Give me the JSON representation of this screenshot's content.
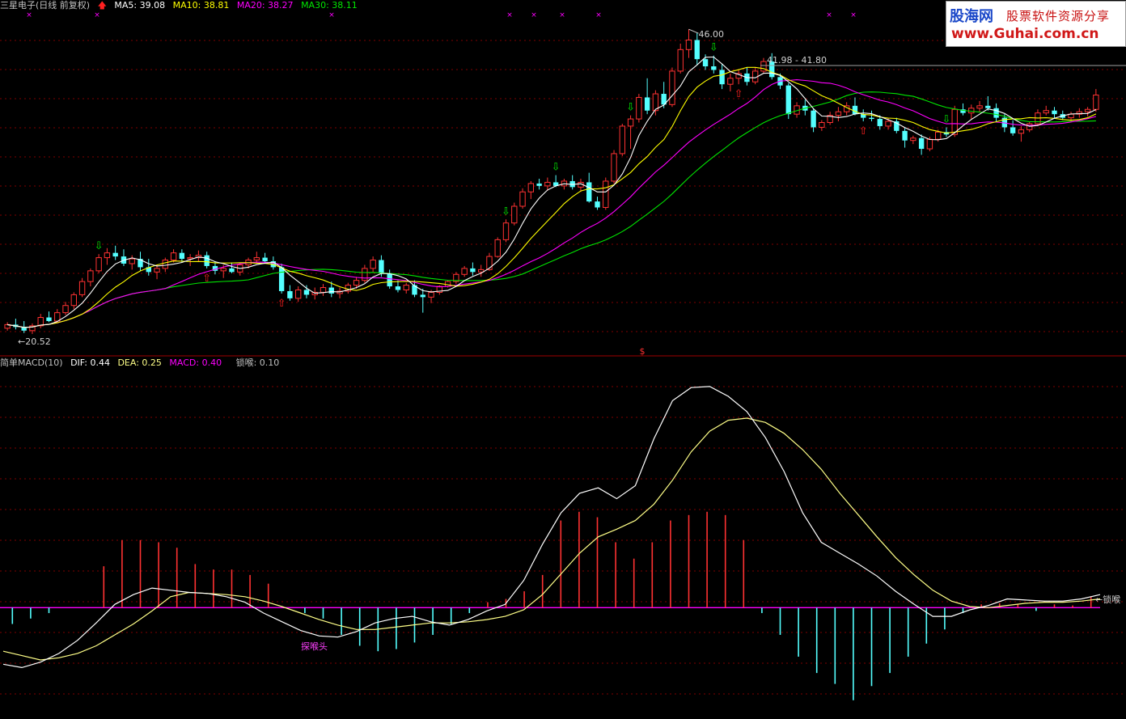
{
  "header": {
    "title": "三星电子(日线 前复权)",
    "ma5": "MA5: 39.08",
    "ma10": "MA10: 38.81",
    "ma20": "MA20: 38.27",
    "ma30": "MA30: 38.11"
  },
  "indicator": {
    "title": "简单MACD(10)",
    "dif": "DIF: 0.44",
    "dea": "DEA: 0.25",
    "macd": "MACD: 0.40",
    "lock": "锁喉: 0.10"
  },
  "annotations": {
    "low_price": "20.52",
    "high_price": "46.00",
    "range_label": "41.98 - 41.80",
    "lock_label": "锁喉",
    "tanhou_label": "探喉头",
    "s_marker": "$"
  },
  "logo": {
    "brand": "股海网",
    "slogan": "股票软件资源分享",
    "url": "www.Guhai.com.cn"
  },
  "colors": {
    "background": "#000000",
    "up_candle": "#ff3232",
    "down_candle": "#54ffff",
    "ma5": "#ffffff",
    "ma10": "#ffff00",
    "ma20": "#ff00ff",
    "ma30": "#00e600",
    "grid": "#800000",
    "macd_pos": "#ff3232",
    "macd_neg": "#54ffff",
    "zero_line": "#ff00ff",
    "dif": "#ffffff",
    "dea": "#ffff88"
  },
  "chart_data": [
    {
      "type": "candlestick",
      "title": "三星电子(日线 前复权)",
      "ylim": [
        19.5,
        47.5
      ],
      "grid": true,
      "candles": [
        [
          21.0,
          21.5,
          20.8,
          21.3
        ],
        [
          21.3,
          21.8,
          20.9,
          21.1
        ],
        [
          21.1,
          21.6,
          20.6,
          20.8
        ],
        [
          20.8,
          21.4,
          20.52,
          21.2
        ],
        [
          21.2,
          22.2,
          21.0,
          21.9
        ],
        [
          21.9,
          22.4,
          21.5,
          21.6
        ],
        [
          21.6,
          22.6,
          21.4,
          22.3
        ],
        [
          22.3,
          23.2,
          22.1,
          22.9
        ],
        [
          22.9,
          24.0,
          22.6,
          23.8
        ],
        [
          23.8,
          25.2,
          23.6,
          24.9
        ],
        [
          24.9,
          26.0,
          24.5,
          25.8
        ],
        [
          25.8,
          27.2,
          25.6,
          26.9
        ],
        [
          26.9,
          27.7,
          26.3,
          27.3
        ],
        [
          27.3,
          27.9,
          26.7,
          27.0
        ],
        [
          27.0,
          27.6,
          26.2,
          26.4
        ],
        [
          26.4,
          27.1,
          25.9,
          26.8
        ],
        [
          26.8,
          27.4,
          25.8,
          26.1
        ],
        [
          26.1,
          26.8,
          25.4,
          25.7
        ],
        [
          25.7,
          26.3,
          25.1,
          26.0
        ],
        [
          26.0,
          26.9,
          25.7,
          26.7
        ],
        [
          26.7,
          27.6,
          26.5,
          27.3
        ],
        [
          27.3,
          27.6,
          26.5,
          26.8
        ],
        [
          26.8,
          27.2,
          26.2,
          26.9
        ],
        [
          26.9,
          27.5,
          26.6,
          27.1
        ],
        [
          27.1,
          27.4,
          26.0,
          26.2
        ],
        [
          26.2,
          26.6,
          25.5,
          25.8
        ],
        [
          25.8,
          26.3,
          25.2,
          26.0
        ],
        [
          26.0,
          26.5,
          25.6,
          25.7
        ],
        [
          25.7,
          26.5,
          25.4,
          26.3
        ],
        [
          26.3,
          26.9,
          26.0,
          26.7
        ],
        [
          26.7,
          27.4,
          26.4,
          26.9
        ],
        [
          26.9,
          27.3,
          26.4,
          26.6
        ],
        [
          26.6,
          27.0,
          25.9,
          26.1
        ],
        [
          26.1,
          26.4,
          23.9,
          24.1
        ],
        [
          24.1,
          24.6,
          23.3,
          23.5
        ],
        [
          23.5,
          24.5,
          23.2,
          24.2
        ],
        [
          24.2,
          24.6,
          23.5,
          23.8
        ],
        [
          23.8,
          24.4,
          23.4,
          24.0
        ],
        [
          24.0,
          24.7,
          23.7,
          24.4
        ],
        [
          24.4,
          24.9,
          23.6,
          23.9
        ],
        [
          23.9,
          24.4,
          23.5,
          24.1
        ],
        [
          24.1,
          24.8,
          23.9,
          24.6
        ],
        [
          24.6,
          25.3,
          24.3,
          25.0
        ],
        [
          25.0,
          26.3,
          24.8,
          26.0
        ],
        [
          26.0,
          27.0,
          25.7,
          26.7
        ],
        [
          26.7,
          27.1,
          25.3,
          25.6
        ],
        [
          25.6,
          25.9,
          24.3,
          24.5
        ],
        [
          24.5,
          25.0,
          24.0,
          24.2
        ],
        [
          24.2,
          24.8,
          23.9,
          24.6
        ],
        [
          24.6,
          25.0,
          23.6,
          23.8
        ],
        [
          23.8,
          24.3,
          22.3,
          23.6
        ],
        [
          23.6,
          24.2,
          23.1,
          24.0
        ],
        [
          24.0,
          24.6,
          23.8,
          24.5
        ],
        [
          24.5,
          25.0,
          24.4,
          24.9
        ],
        [
          24.9,
          25.7,
          24.7,
          25.5
        ],
        [
          25.5,
          26.2,
          25.3,
          26.0
        ],
        [
          26.0,
          26.5,
          25.4,
          25.7
        ],
        [
          25.7,
          26.3,
          25.3,
          25.9
        ],
        [
          25.9,
          27.3,
          25.8,
          27.0
        ],
        [
          27.0,
          28.6,
          26.9,
          28.4
        ],
        [
          28.4,
          30.1,
          28.2,
          29.8
        ],
        [
          29.8,
          31.5,
          29.6,
          31.2
        ],
        [
          31.2,
          32.7,
          31.0,
          32.4
        ],
        [
          32.4,
          33.3,
          31.8,
          33.1
        ],
        [
          33.1,
          33.5,
          32.6,
          32.9
        ],
        [
          32.9,
          33.6,
          32.5,
          33.2
        ],
        [
          33.2,
          33.8,
          32.8,
          32.9
        ],
        [
          32.9,
          33.5,
          32.6,
          33.3
        ],
        [
          33.3,
          33.8,
          32.6,
          32.8
        ],
        [
          32.8,
          33.5,
          32.4,
          33.2
        ],
        [
          33.2,
          34.0,
          31.5,
          31.6
        ],
        [
          31.6,
          32.0,
          30.9,
          31.1
        ],
        [
          31.1,
          33.6,
          30.9,
          33.3
        ],
        [
          33.3,
          35.9,
          33.1,
          35.6
        ],
        [
          35.6,
          38.1,
          35.4,
          37.9
        ],
        [
          37.9,
          38.8,
          36.0,
          38.5
        ],
        [
          38.5,
          40.6,
          38.2,
          40.3
        ],
        [
          40.3,
          41.9,
          38.9,
          39.2
        ],
        [
          39.2,
          40.9,
          38.8,
          40.6
        ],
        [
          40.6,
          41.6,
          39.4,
          39.7
        ],
        [
          39.7,
          42.8,
          39.5,
          42.5
        ],
        [
          42.5,
          44.8,
          42.3,
          44.3
        ],
        [
          44.3,
          46.0,
          43.6,
          45.1
        ],
        [
          45.1,
          45.7,
          43.0,
          43.5
        ],
        [
          43.5,
          43.9,
          42.6,
          42.9
        ],
        [
          42.9,
          43.8,
          42.3,
          42.6
        ],
        [
          42.6,
          43.1,
          41.0,
          41.4
        ],
        [
          41.4,
          42.3,
          40.8,
          41.9
        ],
        [
          41.9,
          42.6,
          41.4,
          42.3
        ],
        [
          42.3,
          42.8,
          41.3,
          41.6
        ],
        [
          41.6,
          42.8,
          41.4,
          42.5
        ],
        [
          42.5,
          43.6,
          42.3,
          43.3
        ],
        [
          43.3,
          44.0,
          41.8,
          42.0
        ],
        [
          42.0,
          42.3,
          41.0,
          41.3
        ],
        [
          41.3,
          41.5,
          38.5,
          38.9
        ],
        [
          38.9,
          39.9,
          38.6,
          39.6
        ],
        [
          39.6,
          40.1,
          38.8,
          39.2
        ],
        [
          39.2,
          39.4,
          37.4,
          37.8
        ],
        [
          37.8,
          38.4,
          37.5,
          38.2
        ],
        [
          38.2,
          39.1,
          38.0,
          38.8
        ],
        [
          38.8,
          39.5,
          38.3,
          39.1
        ],
        [
          39.1,
          39.9,
          38.8,
          39.6
        ],
        [
          39.6,
          40.3,
          38.8,
          38.9
        ],
        [
          38.9,
          39.3,
          38.3,
          38.6
        ],
        [
          38.6,
          39.2,
          38.3,
          38.5
        ],
        [
          38.5,
          38.8,
          37.6,
          37.9
        ],
        [
          37.9,
          38.6,
          37.6,
          38.3
        ],
        [
          38.3,
          38.6,
          37.3,
          37.5
        ],
        [
          37.5,
          37.8,
          36.1,
          36.7
        ],
        [
          36.7,
          37.1,
          36.4,
          36.9
        ],
        [
          36.9,
          37.2,
          35.5,
          36.0
        ],
        [
          36.0,
          37.0,
          35.8,
          36.8
        ],
        [
          36.8,
          37.6,
          36.6,
          37.4
        ],
        [
          37.4,
          37.8,
          37.0,
          37.2
        ],
        [
          37.2,
          39.6,
          37.0,
          39.3
        ],
        [
          39.3,
          39.8,
          38.8,
          39.0
        ],
        [
          39.0,
          39.7,
          38.5,
          39.4
        ],
        [
          39.4,
          40.0,
          39.1,
          39.6
        ],
        [
          39.6,
          40.4,
          39.2,
          39.4
        ],
        [
          39.4,
          39.8,
          38.3,
          38.6
        ],
        [
          38.6,
          38.9,
          37.4,
          37.8
        ],
        [
          37.8,
          38.4,
          37.1,
          37.3
        ],
        [
          37.3,
          37.9,
          36.6,
          37.6
        ],
        [
          37.6,
          38.3,
          37.4,
          38.1
        ],
        [
          38.1,
          39.3,
          37.9,
          39.0
        ],
        [
          39.0,
          39.6,
          38.8,
          39.2
        ],
        [
          39.2,
          39.5,
          38.6,
          38.9
        ],
        [
          38.9,
          39.2,
          38.4,
          38.6
        ],
        [
          38.6,
          39.1,
          38.3,
          38.9
        ],
        [
          38.9,
          39.4,
          38.6,
          39.1
        ],
        [
          39.1,
          39.5,
          38.7,
          39.3
        ],
        [
          39.3,
          41.0,
          39.1,
          40.5
        ]
      ],
      "sell_signal_indices": [
        11,
        60,
        66,
        75,
        85,
        113
      ],
      "buy_signal_indices": [
        24,
        33,
        88,
        103
      ]
    },
    {
      "type": "macd",
      "title": "简单MACD(10)",
      "ylim": [
        -1.0,
        2.2
      ],
      "dif": [
        -0.52,
        -0.55,
        -0.5,
        -0.42,
        -0.3,
        -0.14,
        0.03,
        0.12,
        0.18,
        0.16,
        0.14,
        0.13,
        0.1,
        0.05,
        -0.05,
        -0.13,
        -0.21,
        -0.26,
        -0.27,
        -0.22,
        -0.14,
        -0.1,
        -0.08,
        -0.13,
        -0.16,
        -0.11,
        -0.03,
        0.03,
        0.25,
        0.58,
        0.87,
        1.05,
        1.1,
        1.0,
        1.12,
        1.55,
        1.9,
        2.02,
        2.03,
        1.94,
        1.8,
        1.56,
        1.25,
        0.87,
        0.6,
        0.5,
        0.4,
        0.29,
        0.15,
        0.03,
        -0.08,
        -0.08,
        -0.02,
        0.02,
        0.08,
        0.07,
        0.06,
        0.06,
        0.08,
        0.12
      ],
      "dea": [
        -0.4,
        -0.44,
        -0.48,
        -0.46,
        -0.42,
        -0.35,
        -0.25,
        -0.15,
        -0.03,
        0.1,
        0.14,
        0.13,
        0.12,
        0.1,
        0.06,
        0.01,
        -0.05,
        -0.11,
        -0.16,
        -0.2,
        -0.2,
        -0.18,
        -0.16,
        -0.14,
        -0.14,
        -0.13,
        -0.11,
        -0.08,
        -0.02,
        0.12,
        0.31,
        0.5,
        0.65,
        0.72,
        0.8,
        0.95,
        1.17,
        1.43,
        1.62,
        1.72,
        1.74,
        1.7,
        1.6,
        1.45,
        1.27,
        1.05,
        0.85,
        0.65,
        0.46,
        0.3,
        0.16,
        0.06,
        0.01,
        0.0,
        0.02,
        0.04,
        0.05,
        0.05,
        0.06,
        0.08
      ],
      "histogram": [
        -0.15,
        -0.1,
        -0.05,
        0.0,
        0.0,
        0.38,
        0.62,
        0.62,
        0.6,
        0.55,
        0.4,
        0.35,
        0.35,
        0.3,
        0.22,
        0.0,
        -0.05,
        -0.1,
        -0.25,
        -0.35,
        -0.4,
        -0.38,
        -0.32,
        -0.25,
        -0.15,
        -0.05,
        0.05,
        0.08,
        0.15,
        0.3,
        0.8,
        0.88,
        0.83,
        0.6,
        0.45,
        0.6,
        0.8,
        0.85,
        0.88,
        0.85,
        0.62,
        -0.05,
        -0.25,
        -0.45,
        -0.6,
        -0.7,
        -0.85,
        -0.72,
        -0.6,
        -0.45,
        -0.33,
        -0.2,
        -0.05,
        0.03,
        0.04,
        0.03,
        -0.03,
        0.03,
        0.02,
        0.1
      ],
      "zero_line": true
    }
  ]
}
